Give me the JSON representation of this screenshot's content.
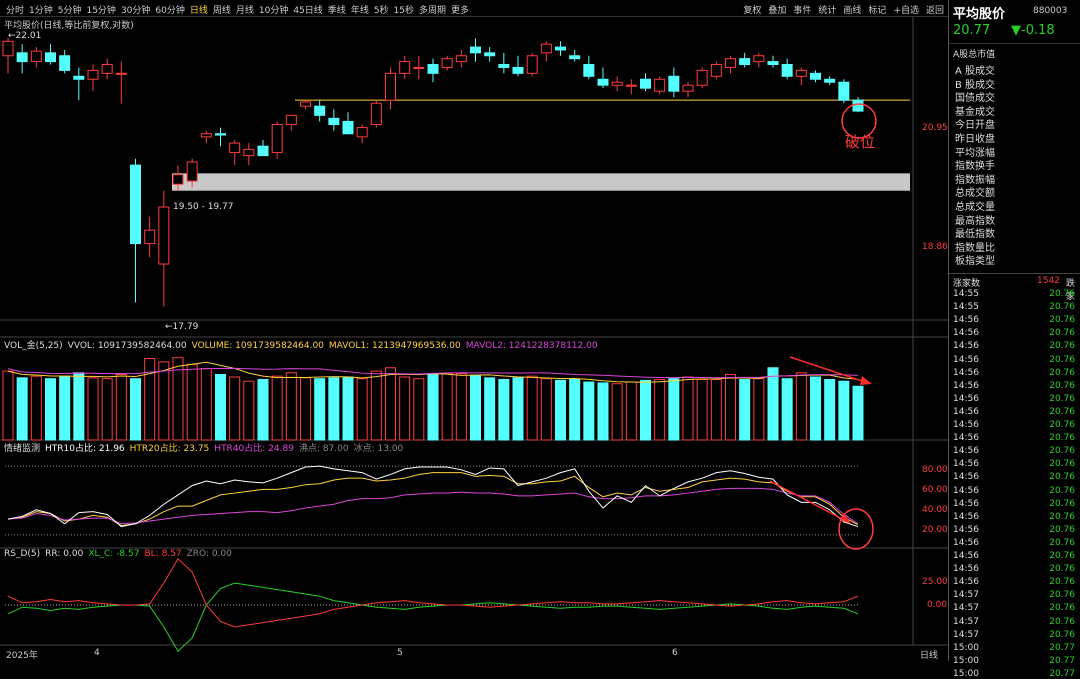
{
  "periods": [
    "分时",
    "1分钟",
    "5分钟",
    "15分钟",
    "30分钟",
    "60分钟",
    "日线",
    "周线",
    "月线",
    "10分钟",
    "45日线",
    "季线",
    "年线",
    "5秒",
    "15秒",
    "多周期",
    "更多"
  ],
  "active_period": "日线",
  "tools": [
    "复权",
    "叠加",
    "事件",
    "统计",
    "画线",
    "标记",
    "+自选",
    "返回"
  ],
  "chart": {
    "title": "平均股价(日线,等比前复权,对数)",
    "high_label": "22.01",
    "low_label": "17.79",
    "zone_label": "19.50 - 19.77",
    "axis_labels": [
      "20.95",
      "18.86"
    ],
    "annotation": "破位",
    "resistance": 20.95,
    "zone": [
      19.5,
      19.77
    ],
    "candle_colors": {
      "up": "#ff3c3c",
      "down": "#54ffff"
    }
  },
  "vol_header": {
    "name": "VOL_金(5,25)",
    "vvol": "VVOL: 1091739582464.00",
    "volume": "VOLUME: 1091739582464.00",
    "mavol1": "MAVOL1: 1213947969536.00",
    "mavol2": "MAVOL2: 1241228378112.00",
    "colors": {
      "volume": "#ffd23c",
      "mavol1": "#ffd23c",
      "mavol2": "#dc46dc"
    }
  },
  "htr_header": {
    "name": "情绪监测",
    "htr10": "HTR10占比: 21.96",
    "htr20": "HTR20占比: 23.75",
    "htr40": "HTR40占比: 24.89",
    "fei": "沸点: 87.00",
    "bing": "冰点: 13.00",
    "colors": {
      "htr10": "#ffffff",
      "htr20": "#ffd23c",
      "htr40": "#dc46dc"
    }
  },
  "htr_axis": [
    "80.00",
    "60.00",
    "40.00",
    "20.00"
  ],
  "rsd_header": {
    "name": "RS_D(5)",
    "rr": "RR: 0.00",
    "xlc": "XL_C: -8.57",
    "bl": "BL: 8.57",
    "zro": "ZRO: 0.00",
    "colors": {
      "xlc": "#26d226",
      "bl": "#ff3c3c"
    }
  },
  "rsd_axis": [
    "25.00",
    "0.00"
  ],
  "date_labels": [
    "2025年",
    "4",
    "5",
    "6"
  ],
  "date_corner": "日线",
  "right_panel": {
    "title": "平均股价",
    "code": "880003",
    "price": "20.77",
    "change": "▼-0.18",
    "market_header": "A股总市值",
    "items": [
      "A 股成交",
      "B 股成交",
      "国债成交",
      "基金成交",
      "今日开盘",
      "昨日收盘",
      "平均涨幅",
      "指数换手",
      "指数振幅",
      "总成交额",
      "总成交量",
      "最高指数",
      "最低指数",
      "指数量比",
      "板指类型"
    ],
    "count_label": "涨家数",
    "count_value": "1542",
    "count_right": "跌家",
    "ticks": [
      [
        "14:55",
        "20.76"
      ],
      [
        "14:55",
        "20.76"
      ],
      [
        "14:56",
        "20.76"
      ],
      [
        "14:56",
        "20.76"
      ],
      [
        "14:56",
        "20.76"
      ],
      [
        "14:56",
        "20.76"
      ],
      [
        "14:56",
        "20.76"
      ],
      [
        "14:56",
        "20.76"
      ],
      [
        "14:56",
        "20.76"
      ],
      [
        "14:56",
        "20.76"
      ],
      [
        "14:56",
        "20.76"
      ],
      [
        "14:56",
        "20.76"
      ],
      [
        "14:56",
        "20.76"
      ],
      [
        "14:56",
        "20.76"
      ],
      [
        "14:56",
        "20.76"
      ],
      [
        "14:56",
        "20.76"
      ],
      [
        "14:56",
        "20.76"
      ],
      [
        "14:56",
        "20.76"
      ],
      [
        "14:56",
        "20.76"
      ],
      [
        "14:56",
        "20.76"
      ],
      [
        "14:56",
        "20.76"
      ],
      [
        "14:56",
        "20.76"
      ],
      [
        "14:56",
        "20.76"
      ],
      [
        "14:57",
        "20.76"
      ],
      [
        "14:57",
        "20.76"
      ],
      [
        "14:57",
        "20.76"
      ],
      [
        "14:57",
        "20.76"
      ],
      [
        "15:00",
        "20.77"
      ],
      [
        "15:00",
        "20.77"
      ],
      [
        "15:00",
        "20.77"
      ]
    ]
  }
}
